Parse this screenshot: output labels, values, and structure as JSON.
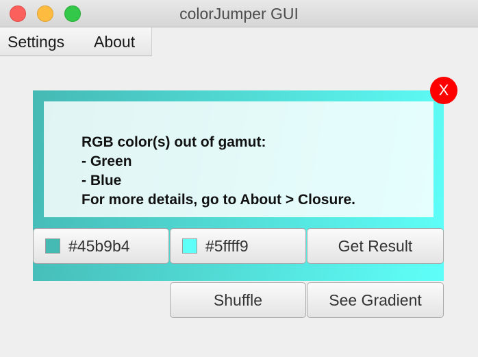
{
  "window": {
    "title": "colorJumper GUI"
  },
  "menubar": {
    "settings": "Settings",
    "about": "About"
  },
  "colors": {
    "color1": "#45b9b4",
    "color2": "#5ffff9",
    "close_badge": "#ff0000"
  },
  "message": {
    "lines": [
      "RGB color(s) out of gamut:",
      "- Green",
      "- Blue",
      "For more details, go to About > Closure."
    ]
  },
  "close_badge": {
    "label": "X"
  },
  "buttons": {
    "color1": {
      "label": "#45b9b4",
      "swatch": "#45b9b4"
    },
    "color2": {
      "label": "#5ffff9",
      "swatch": "#5ffff9"
    },
    "get_result": "Get Result",
    "shuffle": "Shuffle",
    "see_gradient": "See Gradient"
  },
  "icons": {
    "close_window": "close-window-icon",
    "minimize_window": "minimize-window-icon",
    "maximize_window": "maximize-window-icon",
    "close_badge": "close-icon"
  }
}
